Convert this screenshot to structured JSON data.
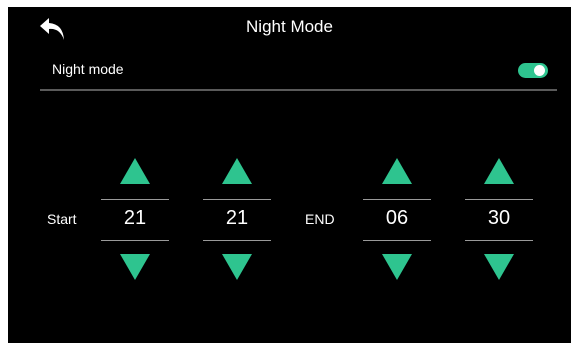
{
  "header": {
    "title": "Night Mode",
    "back_icon": "back-arrow-icon"
  },
  "setting": {
    "label": "Night mode",
    "enabled": true,
    "toggle_color": "#2ec48f"
  },
  "schedule": {
    "start_label": "Start",
    "end_label": "END",
    "start_hour": "21",
    "start_minute": "21",
    "end_hour": "06",
    "end_minute": "30"
  },
  "colors": {
    "background": "#000000",
    "accent": "#2ec48f",
    "divider": "#5a5a5a"
  },
  "icons": {
    "increment": "triangle-up-icon",
    "decrement": "triangle-down-icon"
  }
}
